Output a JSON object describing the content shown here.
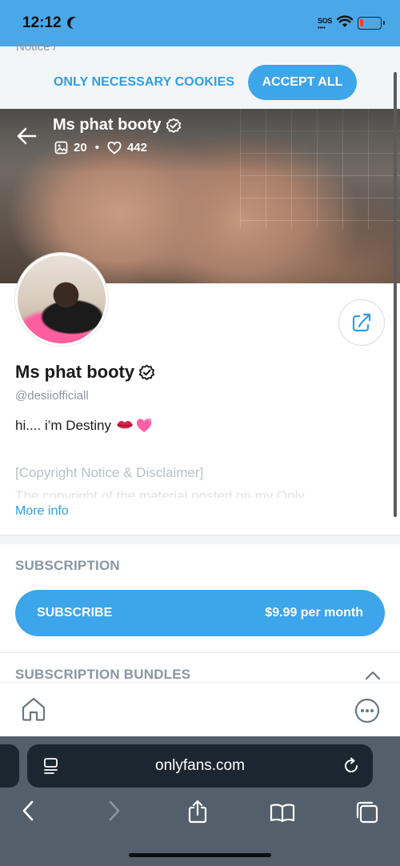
{
  "status_bar": {
    "time": "12:12",
    "sos": "SOS",
    "battery_level": 0.15,
    "background": "#4aa8e8"
  },
  "cookie_banner": {
    "peek_text": "Notice /",
    "only_necessary_label": "ONLY NECESSARY COOKIES",
    "accept_all_label": "ACCEPT ALL"
  },
  "cover": {
    "name": "Ms phat booty",
    "media_count": "20",
    "likes_count": "442"
  },
  "profile": {
    "name": "Ms phat booty",
    "handle": "@desiiofficiall",
    "bio": "hi.... i’m Destiny",
    "bio_emojis": [
      "lips-emoji",
      "heart-emoji"
    ],
    "copyright": "[Copyright Notice & Disclaimer]",
    "truncated_line": "The copyright of the material posted on my Only",
    "more_info": "More info"
  },
  "subscription": {
    "title": "SUBSCRIPTION",
    "subscribe_label": "SUBSCRIBE",
    "price": "$9.99 per month"
  },
  "bundles": {
    "title": "SUBSCRIPTION BUNDLES"
  },
  "app_nav": {
    "icons": [
      "home-icon",
      "more-icon"
    ]
  },
  "browser": {
    "url": "onlyfans.com",
    "toolbar_icons": [
      "back-icon",
      "forward-icon",
      "share-icon",
      "bookmarks-icon",
      "tabs-icon"
    ]
  },
  "colors": {
    "accent": "#3da5ea",
    "muted_text": "#8a96a3",
    "safari_bar": "#53606b"
  }
}
